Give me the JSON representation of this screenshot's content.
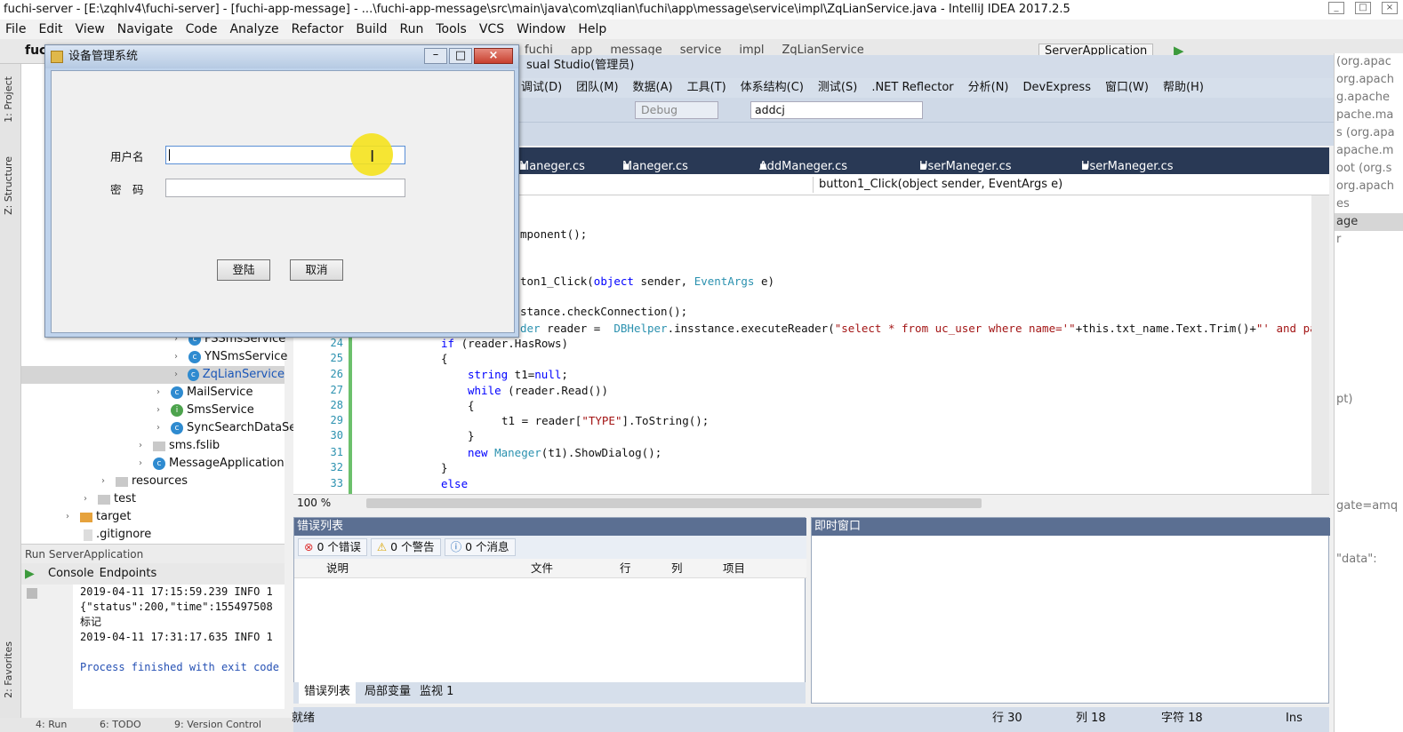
{
  "ij_window": {
    "title_pre": "fuchi-server - [E:\\zqhlv4\\fuchi-server] - [fuchi-app-message] - ...\\fuchi-app-message\\src\\main\\java\\com\\zqlian\\fuchi\\app\\message\\service\\impl\\ZqLianService.java - IntelliJ IDEA 2017.2.5",
    "menu": [
      "File",
      "Edit",
      "View",
      "Navigate",
      "Code",
      "Analyze",
      "Refactor",
      "Build",
      "Run",
      "Tools",
      "VCS",
      "Window",
      "Help"
    ],
    "toolbar_project": "fuc",
    "breadcrumb": [
      "fuchi",
      "app",
      "message",
      "service",
      "impl",
      "ZqLianService"
    ],
    "run_config": "ServerApplication",
    "left_tabs": [
      "1: Project",
      "Z: Structure",
      "2: Favorites"
    ],
    "tree": [
      {
        "label": "FSSmsService",
        "icon": "c"
      },
      {
        "label": "YNSmsService",
        "icon": "c"
      },
      {
        "label": "ZqLianService",
        "icon": "c",
        "selected": true
      },
      {
        "label": "MailService",
        "icon": "c"
      },
      {
        "label": "SmsService",
        "icon": "i"
      },
      {
        "label": "SyncSearchDataSe",
        "icon": "c"
      },
      {
        "label": "sms.fslib",
        "icon": "folder"
      },
      {
        "label": "MessageApplication",
        "icon": "c"
      },
      {
        "label": "resources",
        "icon": "folder"
      },
      {
        "label": "test",
        "icon": "folder"
      },
      {
        "label": "target",
        "icon": "folder-orange"
      },
      {
        "label": ".gitignore",
        "icon": "file"
      }
    ],
    "run_bar": "Run   ServerApplication",
    "run_tabs": [
      "Console",
      "Endpoints"
    ],
    "console_lines": [
      "2019-04-11 17:15:59.239  INFO 1",
      "{\"status\":200,\"time\":155497508",
      "标记",
      "2019-04-11 17:31:17.635  INFO 1",
      "",
      "Process finished with exit code"
    ],
    "bottom_tabs": [
      "4: Run",
      "6: TODO",
      "9: Version Control"
    ],
    "right_panel": [
      "(org.apac",
      "org.apach",
      "g.apache",
      "pache.ma",
      "s (org.apa",
      "apache.m",
      "oot (org.s",
      "org.apach",
      "es",
      "age",
      "r",
      "",
      "",
      "",
      "",
      "",
      "",
      "",
      "",
      "pt)",
      "",
      "",
      "",
      "",
      "",
      "gate=amq",
      "",
      "",
      "\"data\":",
      ""
    ]
  },
  "vs_window": {
    "title": "sual Studio(管理员)",
    "menu": [
      "调试(D)",
      "团队(M)",
      "数据(A)",
      "工具(T)",
      "体系结构(C)",
      "测试(S)",
      ".NET Reflector",
      "分析(N)",
      "DevExpress",
      "窗口(W)",
      "帮助(H)"
    ],
    "config": "Debug",
    "search_combo": "addcj",
    "tabs": [
      "Maneger.cs",
      "Maneger.cs [设计]",
      "AddManeger.cs [设计]",
      "UserManeger.cs [设计]",
      "UserManeger.cs"
    ],
    "method_combo": "button1_Click(object sender, EventArgs e)",
    "zoom": "100 %",
    "code_lines": [
      {
        "n": "",
        "t": [
          [
            "",
            "mponent();"
          ]
        ]
      },
      {
        "n": "",
        "t": [
          [
            "",
            "ton1_Click("
          ],
          [
            "kw",
            "object"
          ],
          [
            "",
            " sender, "
          ],
          [
            "ty",
            "EventArgs"
          ],
          [
            "",
            " e)"
          ]
        ]
      },
      {
        "n": "",
        "t": [
          [
            "",
            "stance.checkConnection();"
          ]
        ]
      },
      {
        "n": "",
        "t": [
          [
            "ty",
            "der"
          ],
          [
            "",
            " reader =  "
          ],
          [
            "ty",
            "DBHelper"
          ],
          [
            "",
            ".insstance.executeReader("
          ],
          [
            "st",
            "\"select * from uc_user where name='\""
          ],
          [
            "",
            "+this.txt_name.Text.Trim()+"
          ],
          [
            "st",
            "\"' and pas"
          ]
        ]
      },
      {
        "n": "24",
        "t": [
          [
            "kw",
            "if"
          ],
          [
            "",
            " (reader.HasRows)"
          ]
        ]
      },
      {
        "n": "25",
        "t": [
          [
            "",
            "{"
          ]
        ]
      },
      {
        "n": "26",
        "t": [
          [
            "kw",
            "string"
          ],
          [
            "",
            " t1="
          ],
          [
            "kw",
            "null"
          ],
          [
            "",
            ";"
          ]
        ]
      },
      {
        "n": "27",
        "t": [
          [
            "kw",
            "while"
          ],
          [
            "",
            " (reader.Read())"
          ]
        ]
      },
      {
        "n": "28",
        "t": [
          [
            "",
            "{"
          ]
        ]
      },
      {
        "n": "29",
        "t": [
          [
            "",
            "t1 = reader["
          ],
          [
            "st",
            "\"TYPE\""
          ],
          [
            "",
            "].ToString();"
          ]
        ]
      },
      {
        "n": "30",
        "t": [
          [
            "",
            "}"
          ]
        ]
      },
      {
        "n": "31",
        "t": [
          [
            "kw",
            "new"
          ],
          [
            "",
            " "
          ],
          [
            "ty",
            "Maneger"
          ],
          [
            "",
            "(t1).ShowDialog();"
          ]
        ]
      },
      {
        "n": "32",
        "t": [
          [
            "",
            "}"
          ]
        ]
      },
      {
        "n": "33",
        "t": [
          [
            "kw",
            "else"
          ]
        ]
      }
    ],
    "error_panel": {
      "title": "错误列表",
      "errors": "0 个错误",
      "warnings": "0 个警告",
      "messages": "0 个消息",
      "columns": [
        "说明",
        "文件",
        "行",
        "列",
        "项目"
      ]
    },
    "immediate_panel": {
      "title": "即时窗口"
    },
    "bottom_tabs": [
      "错误列表",
      "局部变量",
      "监视 1"
    ],
    "status": {
      "ready": "就绪",
      "row": "行 30",
      "col": "列 18",
      "char": "字符 18",
      "mode": "Ins"
    }
  },
  "dialog": {
    "title": "设备管理系统",
    "username_label": "用户名",
    "password_label": "密　码",
    "login_button": "登陆",
    "cancel_button": "取消"
  },
  "colors": {
    "vs_tab_bar": "#293955",
    "vs_panel_header": "#5b6f92",
    "cursor_highlight": "#f5e21d",
    "code_keyword": "#0000ff",
    "code_type": "#2b91af",
    "code_string": "#a31515"
  }
}
